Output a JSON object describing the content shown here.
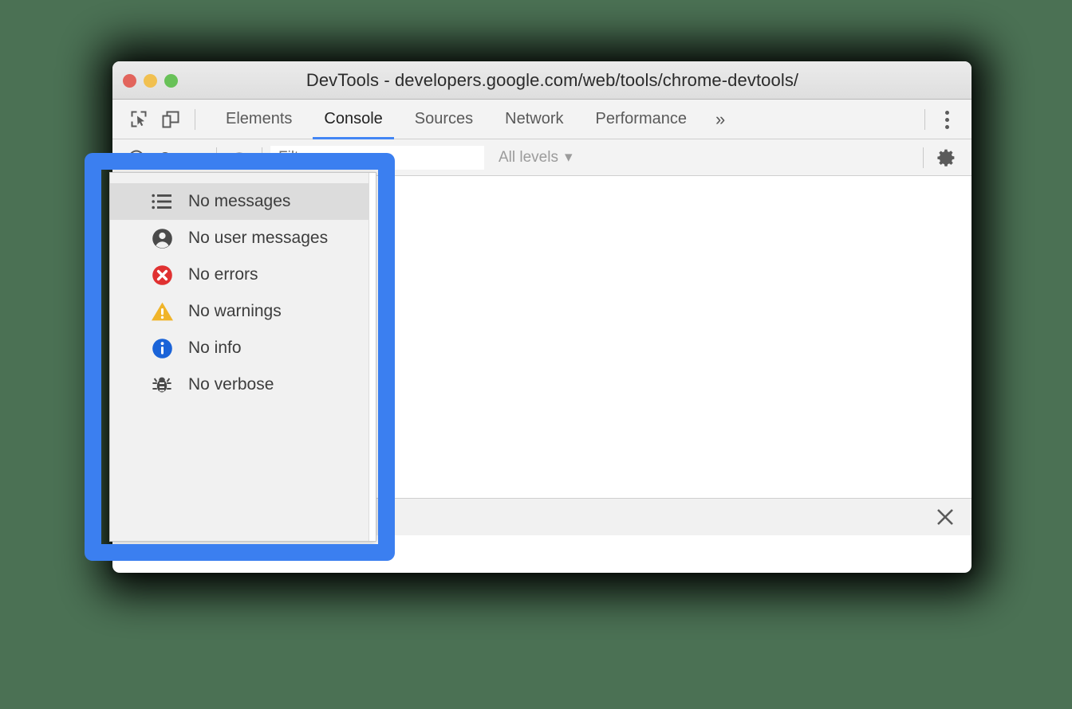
{
  "window": {
    "title": "DevTools - developers.google.com/web/tools/chrome-devtools/",
    "traffic_lights": [
      {
        "name": "close",
        "color": "#e2645c"
      },
      {
        "name": "minimize",
        "color": "#f1c050"
      },
      {
        "name": "zoom",
        "color": "#68c158"
      }
    ]
  },
  "toolbar_left": {
    "inspect_icon": "inspect-element-icon",
    "device_icon": "device-toolbar-icon"
  },
  "main_tabs": [
    {
      "label": "Elements",
      "active": false
    },
    {
      "label": "Console",
      "active": true
    },
    {
      "label": "Sources",
      "active": false
    },
    {
      "label": "Network",
      "active": false
    },
    {
      "label": "Performance",
      "active": false
    }
  ],
  "main_tabs_overflow_label": "»",
  "tabbar_right": {
    "more_menu": "three-dot-menu-icon"
  },
  "console_toolbar": {
    "sidebar_toggle_icon": "chevron-down-icon",
    "eye_icon": "eye-icon",
    "filter_placeholder": "Filter",
    "filter_value": "",
    "levels_label": "All levels",
    "levels_caret": "▾",
    "settings_icon": "gear-icon"
  },
  "console_body": {
    "prompt_caret": "text-caret"
  },
  "levels_dropdown": {
    "items": [
      {
        "label": "No messages",
        "icon": "list-icon",
        "highlighted": true
      },
      {
        "label": "No user messages",
        "icon": "account-circle-icon",
        "highlighted": false
      },
      {
        "label": "No errors",
        "icon": "error-circle-icon",
        "highlighted": false
      },
      {
        "label": "No warnings",
        "icon": "warning-triangle-icon",
        "highlighted": false
      },
      {
        "label": "No info",
        "icon": "info-circle-icon",
        "highlighted": false
      },
      {
        "label": "No verbose",
        "icon": "bug-icon",
        "highlighted": false
      }
    ]
  },
  "drawer": {
    "close_icon": "close-icon"
  },
  "annotation": {
    "shape": "rounded-rectangle-outline",
    "color": "#3b7ff0"
  },
  "colors": {
    "page_background": "#4b7154",
    "accent_blue": "#4285f4",
    "annotation_blue": "#3b7ff0",
    "error_red": "#e03131",
    "warning_yellow": "#f0b429",
    "info_blue": "#1a63d8",
    "highlight_gray": "#dcdcdc"
  }
}
